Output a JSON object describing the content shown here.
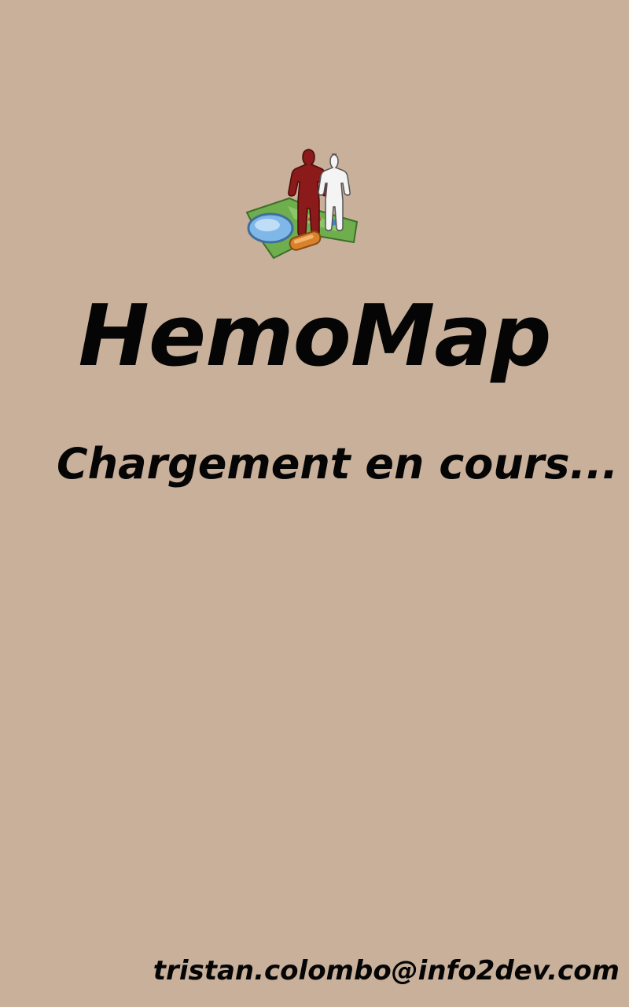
{
  "app": {
    "title": "HemoMap",
    "logo_icon": "hemomap-logo-icon"
  },
  "loading": {
    "message": "Chargement en cours..."
  },
  "footer": {
    "email": "tristan.colombo@info2dev.com"
  },
  "colors": {
    "background": "#c8b09a",
    "text": "#050505",
    "figure_red": "#8b1a1a",
    "figure_white": "#f4f4f4",
    "map_green": "#6fae4c",
    "lens_blue": "#7fb7e8",
    "handle_orange": "#d9822b"
  }
}
